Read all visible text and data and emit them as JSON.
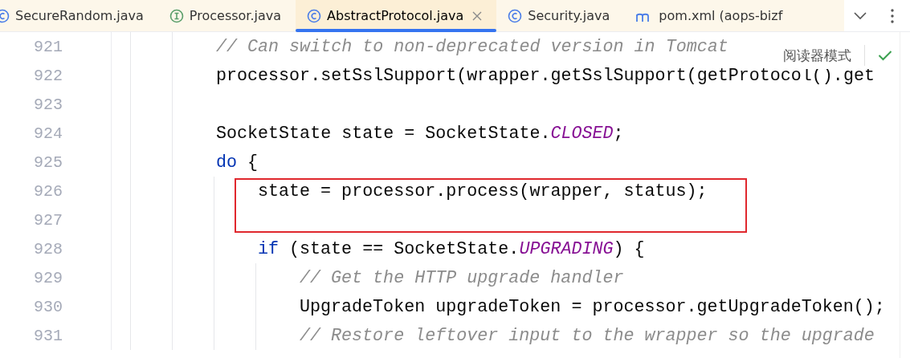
{
  "tabs": [
    {
      "label": "SecureRandom.java",
      "kind": "class",
      "selected": false
    },
    {
      "label": "Processor.java",
      "kind": "interface",
      "selected": false
    },
    {
      "label": "AbstractProtocol.java",
      "kind": "class",
      "selected": true
    },
    {
      "label": "Security.java",
      "kind": "class",
      "selected": false
    },
    {
      "label": "pom.xml (aops-bizf",
      "kind": "maven",
      "selected": false
    }
  ],
  "reader_mode": {
    "label": "阅读器模式"
  },
  "lines": [
    {
      "number": "921",
      "boxed": false,
      "tokens": [
        {
          "kind": "comment",
          "text": "        // Can switch to non-deprecated version in Tomcat"
        }
      ]
    },
    {
      "number": "922",
      "boxed": false,
      "tokens": [
        {
          "kind": "plain",
          "text": "        processor.setSslSupport(wrapper.getSslSupport(getProtocol().get"
        }
      ]
    },
    {
      "number": "923",
      "boxed": false
    },
    {
      "number": "924",
      "boxed": false,
      "tokens": [
        {
          "kind": "plain",
          "text": "        SocketState state = SocketState."
        },
        {
          "kind": "constant",
          "text": "CLOSED"
        },
        {
          "kind": "plain",
          "text": ";"
        }
      ]
    },
    {
      "number": "925",
      "boxed": false,
      "tokens": [
        {
          "kind": "keyword",
          "text": "        do"
        },
        {
          "kind": "plain",
          "text": " {"
        }
      ]
    },
    {
      "number": "926",
      "boxed": true,
      "tokens": [
        {
          "kind": "plain",
          "text": "            state = processor.process(wrapper, status);"
        }
      ]
    },
    {
      "number": "927",
      "boxed": true
    },
    {
      "number": "928",
      "boxed": false,
      "tokens": [
        {
          "kind": "keyword",
          "text": "            if"
        },
        {
          "kind": "plain",
          "text": " (state == SocketState."
        },
        {
          "kind": "constant",
          "text": "UPGRADING"
        },
        {
          "kind": "plain",
          "text": ") {"
        }
      ]
    },
    {
      "number": "929",
      "boxed": false,
      "tokens": [
        {
          "kind": "comment",
          "text": "                // Get the HTTP upgrade handler"
        }
      ]
    },
    {
      "number": "930",
      "boxed": false,
      "tokens": [
        {
          "kind": "plain",
          "text": "                UpgradeToken upgradeToken = processor.getUpgradeToken();"
        }
      ]
    },
    {
      "number": "931",
      "boxed": false,
      "tokens": [
        {
          "kind": "comment",
          "text": "                // Restore leftover input to the wrapper so the upgrade"
        }
      ]
    }
  ]
}
